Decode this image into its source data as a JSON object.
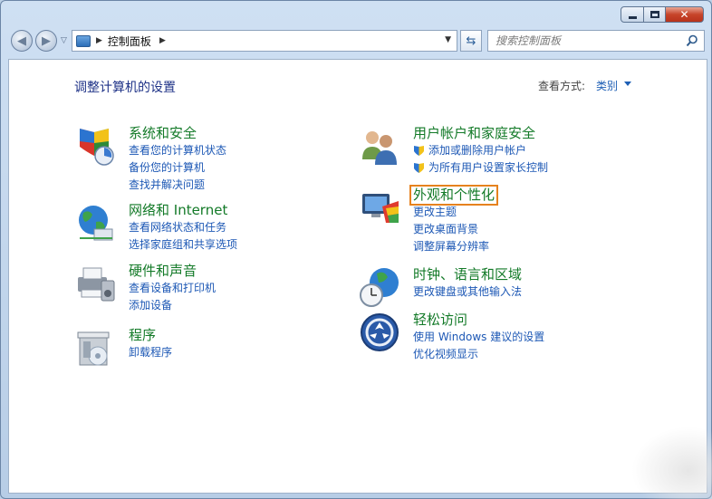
{
  "window": {
    "address_breadcrumb": "控制面板",
    "search_placeholder": "搜索控制面板"
  },
  "main": {
    "title": "调整计算机的设置",
    "view_label": "查看方式:",
    "view_value": "类别"
  },
  "categories": {
    "system": {
      "title": "系统和安全",
      "links": [
        "查看您的计算机状态",
        "备份您的计算机",
        "查找并解决问题"
      ]
    },
    "network": {
      "title": "网络和 Internet",
      "links": [
        "查看网络状态和任务",
        "选择家庭组和共享选项"
      ]
    },
    "hardware": {
      "title": "硬件和声音",
      "links": [
        "查看设备和打印机",
        "添加设备"
      ]
    },
    "programs": {
      "title": "程序",
      "links": [
        "卸载程序"
      ]
    },
    "users": {
      "title": "用户帐户和家庭安全",
      "links": [
        "添加或删除用户帐户",
        "为所有用户设置家长控制"
      ]
    },
    "appearance": {
      "title": "外观和个性化",
      "links": [
        "更改主题",
        "更改桌面背景",
        "调整屏幕分辨率"
      ]
    },
    "clock": {
      "title": "时钟、语言和区域",
      "links": [
        "更改键盘或其他输入法"
      ]
    },
    "ease": {
      "title": "轻松访问",
      "links": [
        "使用 Windows 建议的设置",
        "优化视频显示"
      ]
    }
  },
  "colors": {
    "link": "#1d58b5",
    "category_title": "#137a28",
    "selection": "#e6821e"
  }
}
